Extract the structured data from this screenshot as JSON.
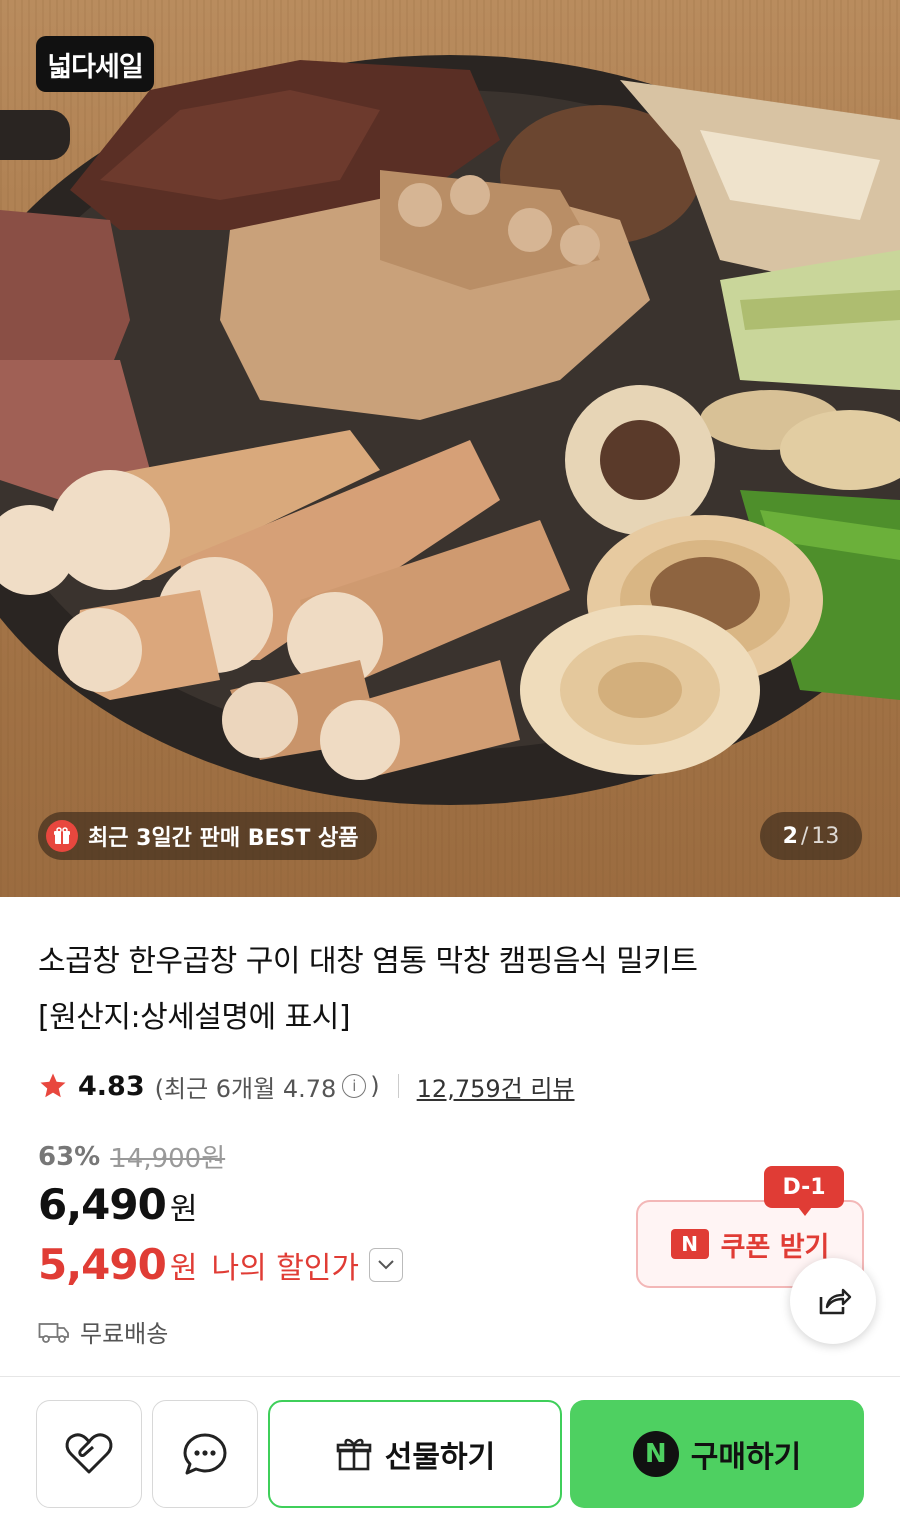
{
  "hero": {
    "sale_badge": "넓다세일",
    "best_chip": "최근 3일간 판매 BEST 상품",
    "pager": {
      "current": "2",
      "separator": "/",
      "total": "13"
    }
  },
  "product": {
    "title_line1": "소곱창 한우곱창 구이 대창 염통 막창 캠핑음식 밀키트",
    "title_line2": "[원산지:상세설명에 표시]",
    "rating": "4.83",
    "recent_rating_prefix": "(최근 6개월 4.78",
    "recent_rating_suffix": ")",
    "info_icon": "i",
    "reviews": "12,759건 리뷰",
    "discount_percent": "63%",
    "original_price": "14,900원",
    "price": "6,490",
    "price_unit": "원",
    "my_price": "5,490",
    "my_price_unit": "원",
    "my_price_label": "나의 할인가",
    "shipping": "무료배송"
  },
  "coupon": {
    "dday": "D-1",
    "badge": "N",
    "label": "쿠폰 받기"
  },
  "actions": {
    "gift_label": "선물하기",
    "buy_label": "구매하기",
    "buy_badge": "N"
  },
  "colors": {
    "accent_red": "#e03c35",
    "naver_green": "#4ed061",
    "star": "#e8473e"
  },
  "icons": [
    "gift-icon",
    "star-icon",
    "info-icon",
    "chevron-down-icon",
    "truck-icon",
    "share-icon",
    "heart-icon",
    "chat-icon"
  ]
}
